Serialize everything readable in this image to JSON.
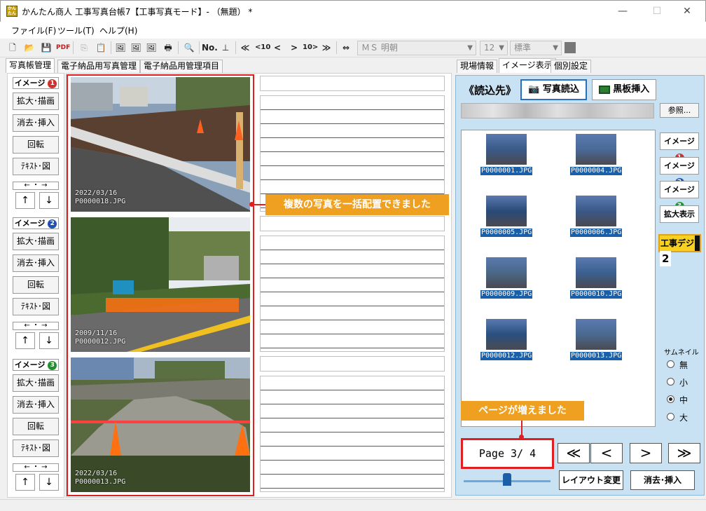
{
  "window": {
    "icon_text": "かんたん",
    "title": "かんたん商人 工事写真台帳7【工事写真モード】- （無題） *",
    "min": "—",
    "max": "☐",
    "close": "✕"
  },
  "menu": {
    "file": "ファイル(F)",
    "tools": "ツール(T)",
    "help": "ヘルプ(H)"
  },
  "toolbar": {
    "number_label": "No.",
    "font_name": "ＭＳ 明朝",
    "font_size": "12",
    "style": "標準",
    "icons": [
      "new-file-icon",
      "open-folder-icon",
      "save-icon",
      "pdf-icon",
      "copy-icon",
      "paste-icon",
      "image-icon",
      "image-icon",
      "image-icon",
      "print-icon",
      "search-icon",
      "number-icon",
      "anchor-icon",
      "first-page-icon",
      "back-10-icon",
      "prev-icon",
      "next-icon",
      "forward-10-icon",
      "last-page-icon",
      "resize-icon"
    ]
  },
  "left_tabs": [
    "写真帳管理",
    "電子納品用写真管理",
    "電子納品用管理項目"
  ],
  "right_tabs": [
    "現場情報",
    "イメージ表示",
    "個別設定"
  ],
  "image_groups": [
    {
      "title": "イメージ",
      "num": "1",
      "color": "#d03030",
      "buttons": [
        "拡大･描画",
        "消去･挿入",
        "回転",
        "ﾃｷｽﾄ･図"
      ],
      "arrows": "← ・ →",
      "up": "↑",
      "down": "↓"
    },
    {
      "title": "イメージ",
      "num": "2",
      "color": "#2050b0",
      "buttons": [
        "拡大･描画",
        "消去･挿入",
        "回転",
        "ﾃｷｽﾄ･図"
      ],
      "arrows": "← ・ →",
      "up": "↑",
      "down": "↓"
    },
    {
      "title": "イメージ",
      "num": "3",
      "color": "#209030",
      "buttons": [
        "拡大･描画",
        "消去･挿入",
        "回転",
        "ﾃｷｽﾄ･図"
      ],
      "arrows": "← ・ →",
      "up": "↑",
      "down": "↓"
    }
  ],
  "photos": [
    {
      "date": "2022/03/16",
      "file": "P0000018.JPG"
    },
    {
      "date": "2009/11/16",
      "file": "P0000012.JPG"
    },
    {
      "date": "2022/03/16",
      "file": "P0000013.JPG"
    }
  ],
  "callouts": {
    "multi": "複数の写真を一括配置できました",
    "pages": "ページが増えました"
  },
  "loader": {
    "label": "《読込先》",
    "load_button": "写真読込",
    "board_button": "黒板挿入",
    "browse_button": "参照..."
  },
  "thumbnails": [
    "P0000001.JPG",
    "P0000004.JPG",
    "P0000005.JPG",
    "P0000006.JPG",
    "P0000009.JPG",
    "P0000010.JPG",
    "P0000012.JPG",
    "P0000013.JPG"
  ],
  "side_buttons": {
    "img1": "イメージ",
    "img1_num": "1",
    "img2": "イメージ",
    "img2_num": "2",
    "img3": "イメージ",
    "img3_num": "3",
    "zoom": "拡大表示",
    "koji_label": "工事デジ",
    "koji_num": "2"
  },
  "thumbnail_size": {
    "label": "サムネイル",
    "options": [
      "無",
      "小",
      "中",
      "大"
    ],
    "selected": "中"
  },
  "pager": {
    "page_text": "Page 3/ 4",
    "first": "≪",
    "prev": "<",
    "next": ">",
    "last": "≫",
    "slider_value": 0.5,
    "layout_button": "レイアウト変更",
    "delete_insert_button": "消去･挿入"
  },
  "colors": {
    "accent_red": "#e02020",
    "callout_orange": "#f0a020",
    "panel_blue": "#c9e2f3",
    "selection_blue": "#1a5fa8"
  }
}
